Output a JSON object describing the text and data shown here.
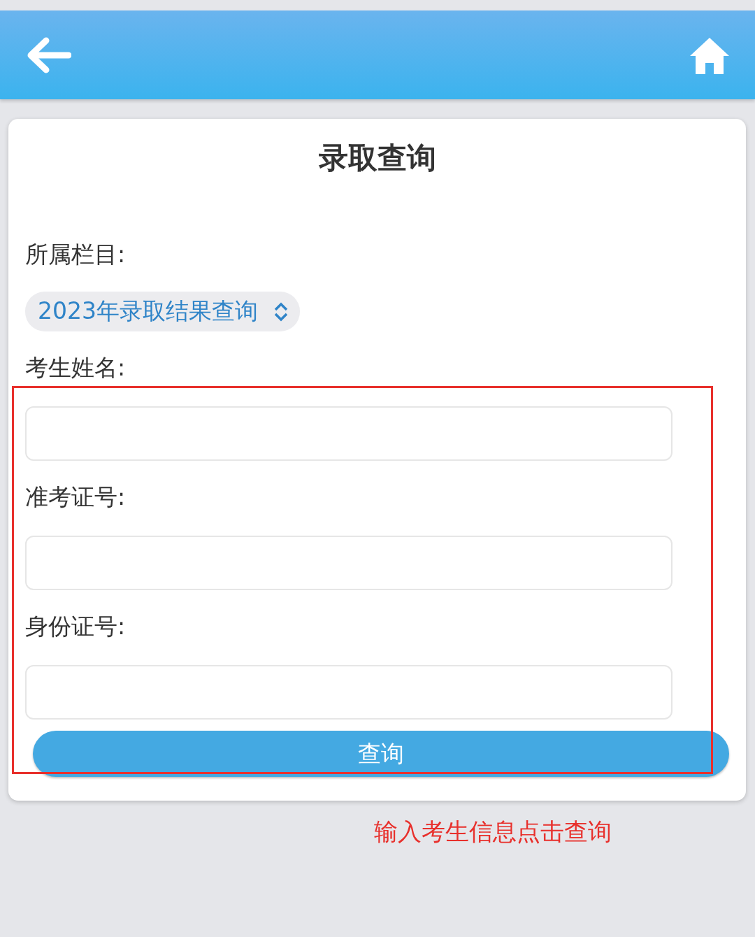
{
  "title": "录取查询",
  "category": {
    "label": "所属栏目:",
    "value": "2023年录取结果查询"
  },
  "fields": [
    {
      "label": "考生姓名:"
    },
    {
      "label": "准考证号:"
    },
    {
      "label": "身份证号:"
    }
  ],
  "submit": "查询",
  "annotation": {
    "note": "输入考生信息点击查询"
  }
}
